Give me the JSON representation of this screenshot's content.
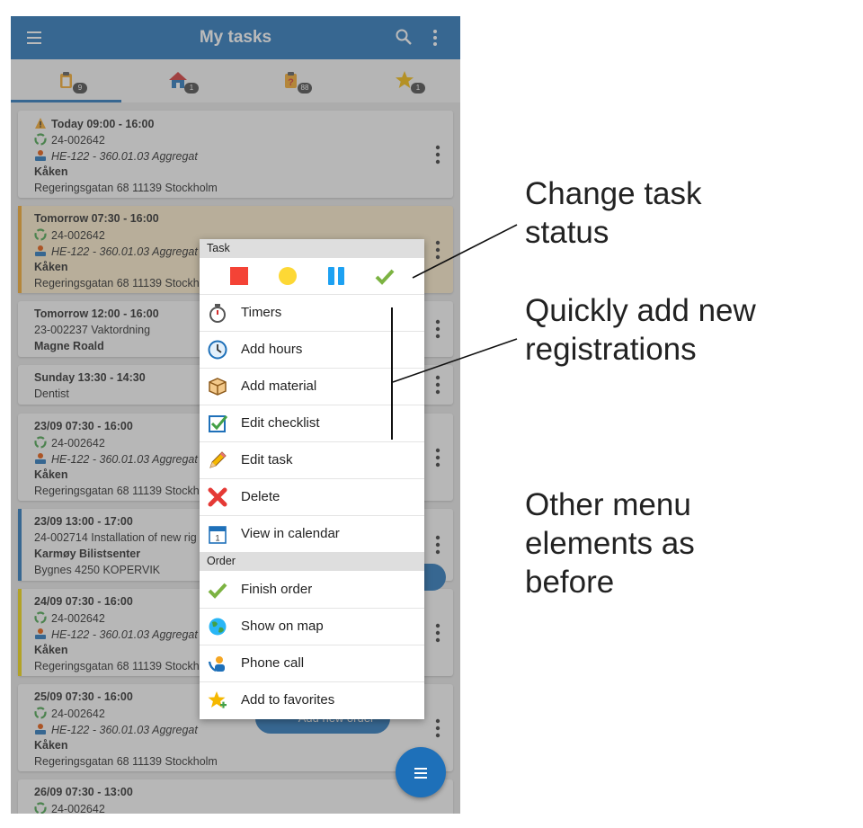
{
  "appbar": {
    "title": "My tasks",
    "menu_icon": "hamburger-menu-icon",
    "search_icon": "search-icon",
    "more_icon": "more-vertical-icon",
    "color": "#1e70b9"
  },
  "tabs": [
    {
      "icon": "clipboard-tasks-icon",
      "badge": "9",
      "active": true
    },
    {
      "icon": "house-icon",
      "badge": "1",
      "active": false
    },
    {
      "icon": "clipboard-question-icon",
      "badge": "88",
      "active": false
    },
    {
      "icon": "star-icon",
      "badge": "1",
      "active": false
    }
  ],
  "tasks": [
    {
      "time": "Today 09:00 - 16:00",
      "order": "24-002642",
      "item": "HE-122 - 360.01.03 Aggregat",
      "customer": "Kåken",
      "address": "Regeringsgatan 68 11139 Stockholm"
    },
    {
      "time": "Tomorrow 07:30 - 16:00",
      "order": "24-002642",
      "item": "HE-122 - 360.01.03 Aggregat",
      "customer": "Kåken",
      "address": "Regeringsgatan 68 11139 Stockholm"
    },
    {
      "time": "Tomorrow 12:00 - 16:00",
      "order": "23-002237 Vaktordning",
      "customer": "Magne Roald"
    },
    {
      "time": "Sunday 13:30 - 14:30",
      "order": "Dentist"
    },
    {
      "time": "23/09 07:30 - 16:00",
      "order": "24-002642",
      "item": "HE-122 - 360.01.03 Aggregat",
      "customer": "Kåken",
      "address": "Regeringsgatan 68 11139 Stockholm"
    },
    {
      "time": "23/09 13:00 - 17:00",
      "order": "24-002714 Installation of new rig",
      "customer": "Karmøy Bilistsenter",
      "address": "Bygnes 4250 KOPERVIK"
    },
    {
      "time": "24/09 07:30 - 16:00",
      "order": "24-002642",
      "item": "HE-122 - 360.01.03 Aggregat",
      "customer": "Kåken",
      "address": "Regeringsgatan 68 11139 Stockholm"
    },
    {
      "time": "25/09 07:30 - 16:00",
      "order": "24-002642",
      "item": "HE-122 - 360.01.03 Aggregat",
      "customer": "Kåken",
      "address": "Regeringsgatan 68 11139 Stockholm"
    },
    {
      "time": "26/09 07:30 - 13:00",
      "order": "24-002642"
    }
  ],
  "add_order_label": "Add new order",
  "fab_icon": "list-menu-icon",
  "context_menu": {
    "task_section": "Task",
    "status_buttons": [
      {
        "icon": "stop-square-icon",
        "color": "#f44336"
      },
      {
        "icon": "pending-circle-icon",
        "color": "#fdd835"
      },
      {
        "icon": "pause-icon",
        "color": "#1da1f2"
      },
      {
        "icon": "checkmark-icon",
        "color": "#7cb342"
      }
    ],
    "task_items": [
      {
        "label": "Timers",
        "icon": "stopwatch-icon"
      },
      {
        "label": "Add hours",
        "icon": "clock-icon"
      },
      {
        "label": "Add material",
        "icon": "box-icon"
      },
      {
        "label": "Edit checklist",
        "icon": "checklist-icon"
      },
      {
        "label": "Edit task",
        "icon": "pencil-icon"
      },
      {
        "label": "Delete",
        "icon": "delete-x-icon"
      },
      {
        "label": "View in calendar",
        "icon": "calendar-icon"
      }
    ],
    "order_section": "Order",
    "order_items": [
      {
        "label": "Finish order",
        "icon": "checkmark-icon"
      },
      {
        "label": "Show on map",
        "icon": "globe-icon"
      },
      {
        "label": "Phone call",
        "icon": "phone-contact-icon"
      },
      {
        "label": "Add to favorites",
        "icon": "star-add-icon"
      }
    ]
  },
  "annotations": {
    "status": [
      "Change task",
      "status"
    ],
    "registrations": [
      "Quickly add new",
      "registrations"
    ],
    "other": [
      "Other menu",
      "elements as",
      "before"
    ]
  }
}
